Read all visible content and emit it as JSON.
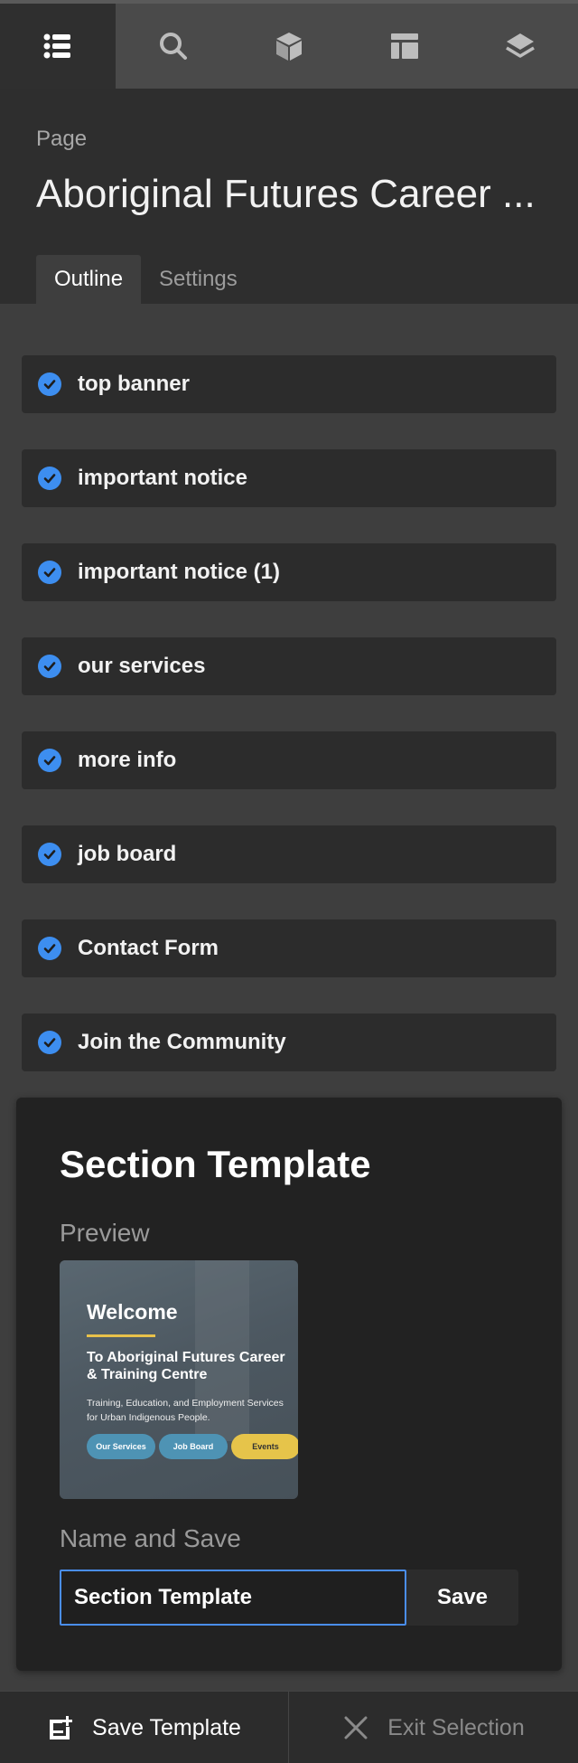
{
  "toolbar": {
    "icons": [
      "list-icon",
      "search-icon",
      "cube-icon",
      "layout-icon",
      "layers-icon"
    ],
    "active_index": 0
  },
  "header": {
    "page_label": "Page",
    "page_title": "Aboriginal Futures Career ...",
    "tabs": [
      {
        "label": "Outline",
        "active": true
      },
      {
        "label": "Settings",
        "active": false
      }
    ]
  },
  "outline": {
    "items": [
      {
        "label": "top banner",
        "checked": true
      },
      {
        "label": "important notice",
        "checked": true
      },
      {
        "label": "important notice (1)",
        "checked": true
      },
      {
        "label": "our services",
        "checked": true
      },
      {
        "label": "more info",
        "checked": true
      },
      {
        "label": "job board",
        "checked": true
      },
      {
        "label": "Contact Form",
        "checked": true
      },
      {
        "label": "Join the Community",
        "checked": true
      }
    ]
  },
  "section_template": {
    "title": "Section Template",
    "preview_label": "Preview",
    "preview": {
      "welcome": "Welcome",
      "heading": "To Aboriginal Futures Career & Training Centre",
      "subtext": "Training, Education, and Employment Services for Urban Indigenous People.",
      "buttons": [
        "Our Services",
        "Job Board",
        "Events"
      ]
    },
    "name_label": "Name and Save",
    "name_value": "Section Template",
    "save_label": "Save"
  },
  "bottom_bar": {
    "save_template_label": "Save Template",
    "exit_selection_label": "Exit Selection"
  },
  "colors": {
    "accent": "#3d8ef0",
    "panel_bg": "#222222",
    "row_bg": "#2c2c2c",
    "preview_gold": "#e6c44a",
    "preview_blue": "#4e93b4"
  }
}
